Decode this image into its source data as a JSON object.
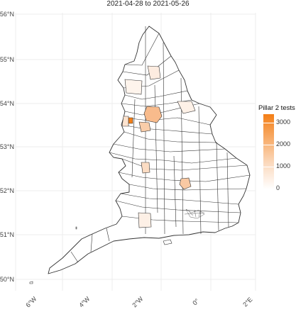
{
  "title": "2021-04-28 to 2021-05-26",
  "legend": {
    "title": "Pillar 2 tests",
    "ticks": [
      "3000",
      "2000",
      "1000",
      "0"
    ],
    "color_high": "#f47f17",
    "color_low": "#ffffff"
  },
  "axes": {
    "y_labels": [
      "56°N",
      "55°N",
      "54°N",
      "53°N",
      "52°N",
      "51°N",
      "50°N"
    ],
    "x_labels": [
      "6°W",
      "4°W",
      "2°W",
      "0°",
      "2°E"
    ]
  },
  "map": {
    "region": "England",
    "outline_color": "#333333",
    "background": "#ffffff",
    "grid_color": "#e8e8e8"
  },
  "highlights": [
    {
      "area": "north-west-high",
      "value": 3000
    },
    {
      "area": "yorkshire-a",
      "value": 1200
    },
    {
      "area": "yorkshire-b",
      "value": 800
    },
    {
      "area": "midlands-east",
      "value": 900
    },
    {
      "area": "midlands-west",
      "value": 600
    },
    {
      "area": "lancashire",
      "value": 500
    },
    {
      "area": "northumberland-east",
      "value": 300
    },
    {
      "area": "east-riding",
      "value": 200
    }
  ]
}
